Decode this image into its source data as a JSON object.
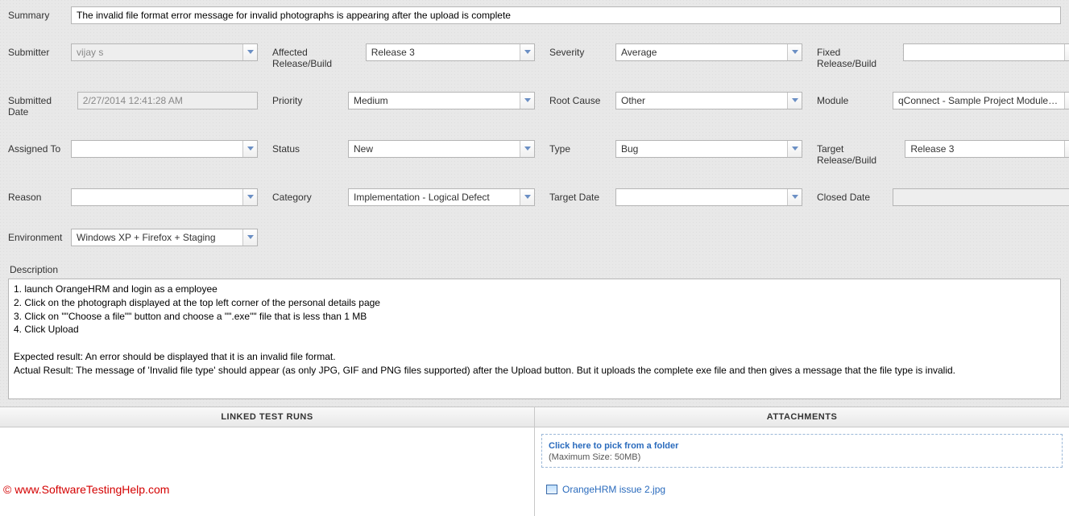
{
  "summary": {
    "label": "Summary",
    "value": "The invalid file format error message for invalid photographs is appearing after the upload is complete"
  },
  "fields": {
    "submitter": {
      "label": "Submitter",
      "value": "vijay s"
    },
    "affected_release": {
      "label": "Affected Release/Build",
      "value": "Release 3"
    },
    "severity": {
      "label": "Severity",
      "value": "Average"
    },
    "fixed_release": {
      "label": "Fixed Release/Build",
      "value": ""
    },
    "submitted_date": {
      "label": "Submitted Date",
      "value": "2/27/2014 12:41:28 AM"
    },
    "priority": {
      "label": "Priority",
      "value": "Medium"
    },
    "root_cause": {
      "label": "Root Cause",
      "value": "Other"
    },
    "module": {
      "label": "Module",
      "value": "qConnect - Sample Project Module root"
    },
    "assigned_to": {
      "label": "Assigned To",
      "value": ""
    },
    "status": {
      "label": "Status",
      "value": "New"
    },
    "type": {
      "label": "Type",
      "value": "Bug"
    },
    "target_release": {
      "label": "Target Release/Build",
      "value": "Release 3"
    },
    "reason": {
      "label": "Reason",
      "value": ""
    },
    "category": {
      "label": "Category",
      "value": "Implementation - Logical Defect"
    },
    "target_date": {
      "label": "Target Date",
      "value": ""
    },
    "closed_date": {
      "label": "Closed Date",
      "value": ""
    },
    "environment": {
      "label": "Environment",
      "value": "Windows XP + Firefox + Staging"
    }
  },
  "description": {
    "label": "Description",
    "value": "1. launch OrangeHRM and login as a employee\n2. Click on the photograph displayed at the top left corner of the personal details page\n3. Click on \"\"Choose a file\"\" button and choose a \"\".exe\"\" file that is less than 1 MB\n4. Click Upload\n\nExpected result: An error should be displayed that it is an invalid file format.\nActual Result: The message of 'Invalid file type' should appear (as only JPG, GIF and PNG files supported) after the Upload button. But it uploads the complete exe file and then gives a message that the file type is invalid."
  },
  "panels": {
    "linked_runs": {
      "title": "LINKED TEST RUNS"
    },
    "attachments": {
      "title": "ATTACHMENTS",
      "pick_text": "Click here to pick from a folder",
      "max_size": "(Maximum Size: 50MB)",
      "items": [
        "OrangeHRM issue 2.jpg"
      ]
    }
  },
  "watermark": "© www.SoftwareTestingHelp.com"
}
